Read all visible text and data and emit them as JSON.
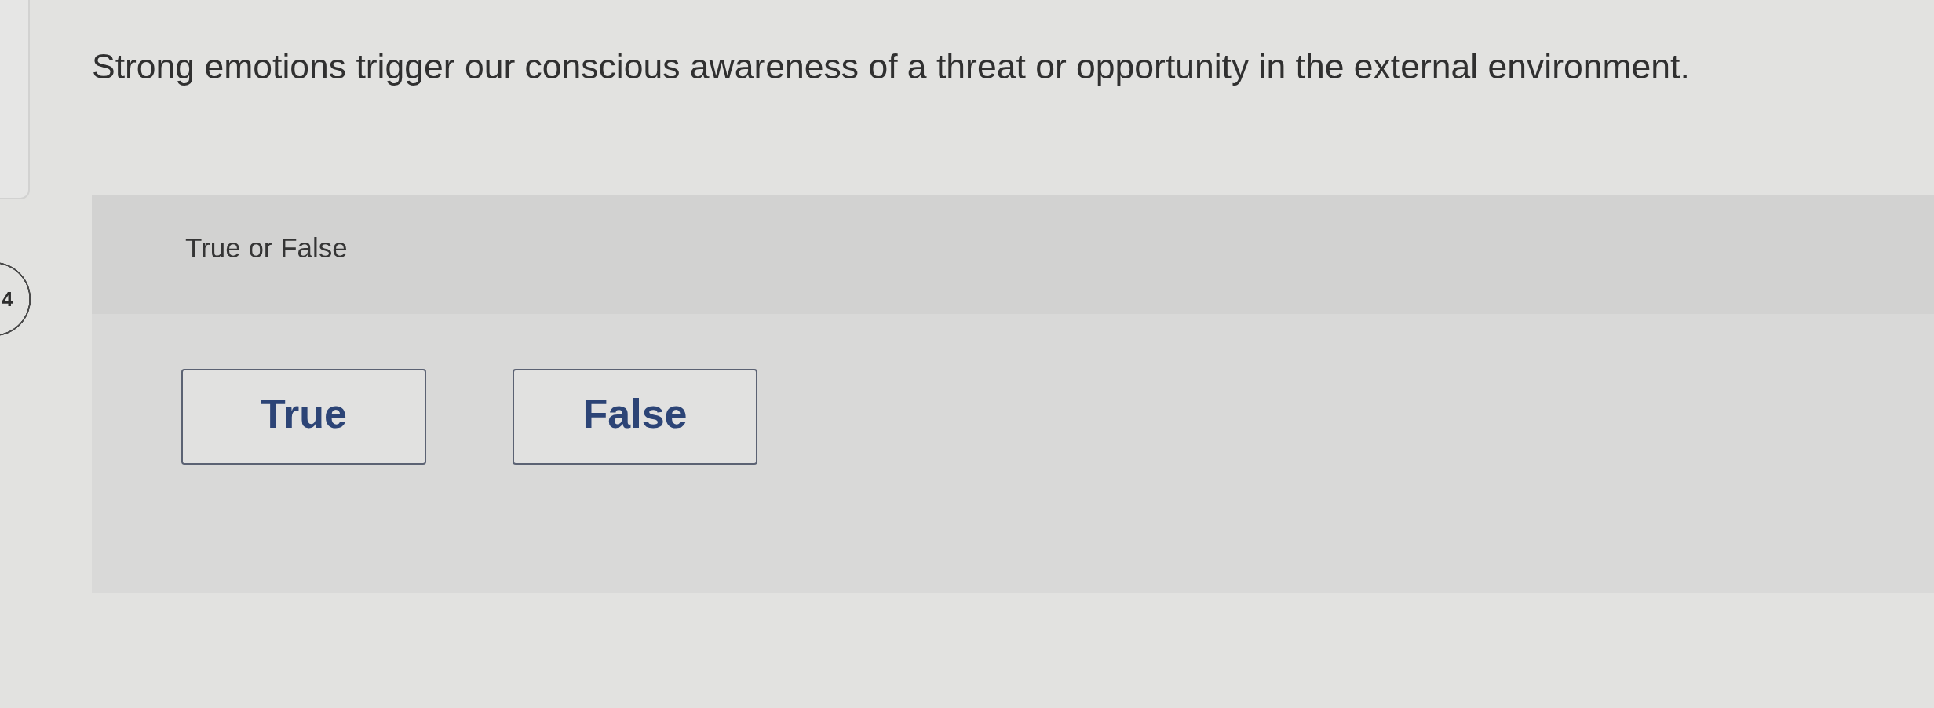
{
  "question_number": "4",
  "question": {
    "text": "Strong emotions trigger our conscious awareness of a threat or opportunity in the external environment."
  },
  "answer_panel": {
    "prompt": "True or False",
    "choices": [
      {
        "label": "True",
        "selected": false
      },
      {
        "label": "False",
        "selected": false
      }
    ]
  }
}
